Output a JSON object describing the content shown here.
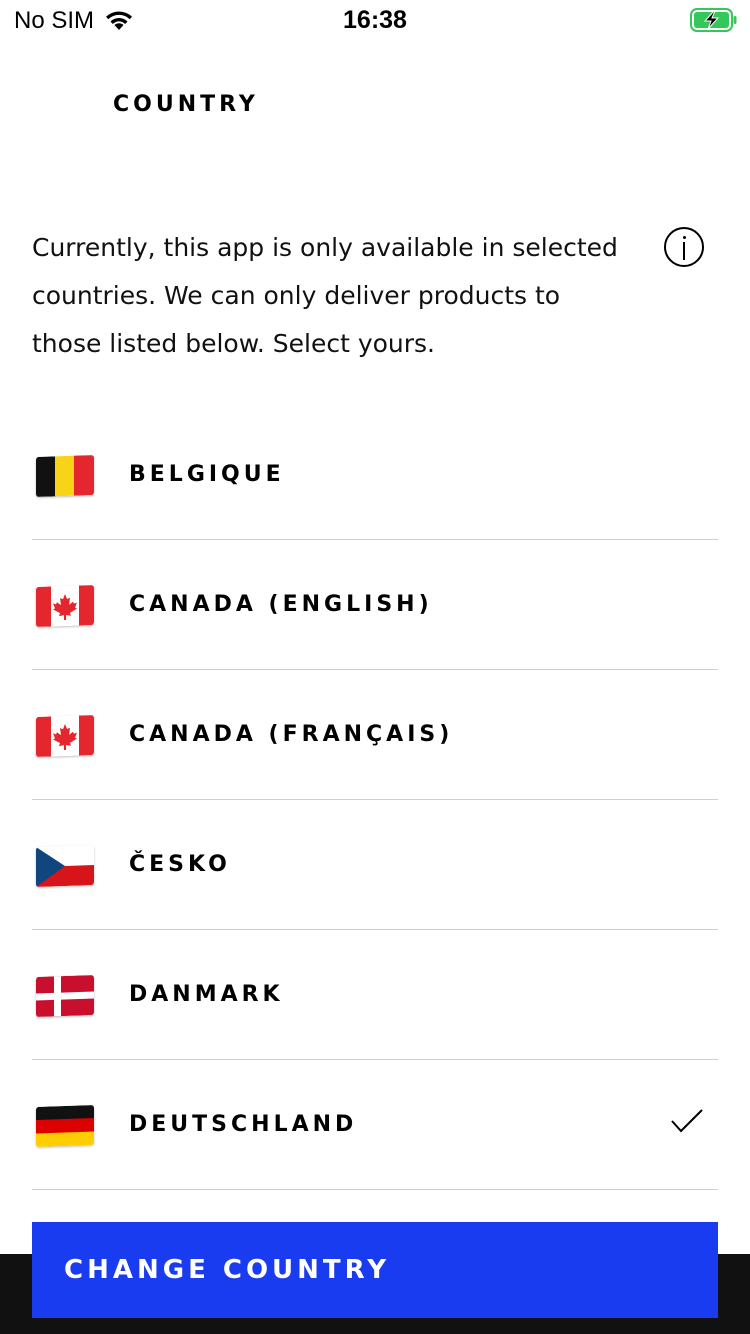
{
  "status_bar": {
    "carrier": "No SIM",
    "time": "16:38"
  },
  "header": {
    "title": "COUNTRY"
  },
  "intro": {
    "text": "Currently, this app is only available in selected countries. We can only deliver products to those listed below. Select yours."
  },
  "countries": [
    {
      "label": "BELGIQUE",
      "flag": "belgium-flag-icon",
      "selected": false
    },
    {
      "label": "CANADA (ENGLISH)",
      "flag": "canada-flag-icon",
      "selected": false
    },
    {
      "label": "CANADA (FRANÇAIS)",
      "flag": "canada-flag-icon",
      "selected": false
    },
    {
      "label": "ČESKO",
      "flag": "czech-flag-icon",
      "selected": false
    },
    {
      "label": "DANMARK",
      "flag": "denmark-flag-icon",
      "selected": false
    },
    {
      "label": "DEUTSCHLAND",
      "flag": "germany-flag-icon",
      "selected": true
    }
  ],
  "cta": {
    "label": "CHANGE COUNTRY"
  },
  "colors": {
    "accent": "#1a3cf0",
    "battery": "#34c759",
    "divider": "#cfcfcf"
  }
}
